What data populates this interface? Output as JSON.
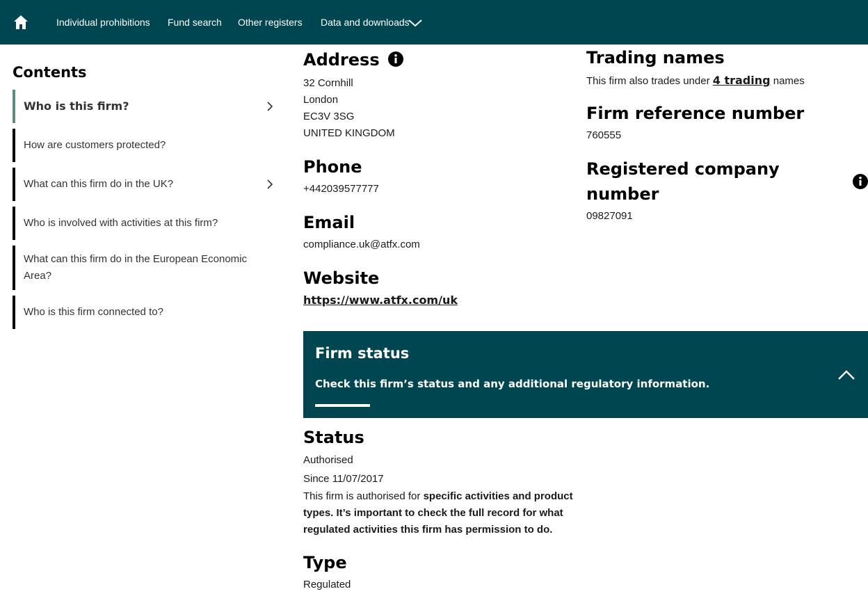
{
  "nav": {
    "home_icon": "home-icon",
    "items": [
      {
        "label": "Individual prohibitions"
      },
      {
        "label": "Fund search"
      },
      {
        "label": "Other registers"
      },
      {
        "label": "Data and downloads"
      }
    ]
  },
  "sidebar": {
    "title": "Contents",
    "items": [
      {
        "label": "Who is this firm?"
      },
      {
        "label": "How are customers protected?"
      },
      {
        "label": "What can this firm do in the UK?"
      },
      {
        "label": "Who is involved with activities at this firm?"
      },
      {
        "label": "What can this firm do in the European Economic Area?"
      },
      {
        "label": "Who is this firm connected to?"
      }
    ]
  },
  "address": {
    "heading": "Address",
    "lines": [
      "32 Cornhill",
      "London",
      "EC3V 3SG",
      "UNITED KINGDOM"
    ]
  },
  "phone": {
    "heading": "Phone",
    "value": "+442039577777"
  },
  "email": {
    "heading": "Email",
    "value": "compliance.uk@atfx.com"
  },
  "website": {
    "heading": "Website",
    "value": "https://www.atfx.com/uk"
  },
  "trading": {
    "heading": "Trading names",
    "text_before": "This firm also trades under ",
    "link": "4 trading",
    "text_after": " names"
  },
  "frn": {
    "heading": "Firm reference number",
    "value": "760555"
  },
  "company": {
    "heading_line1": "Registered company",
    "heading_line2": "number",
    "value": "09827091"
  },
  "firm_status": {
    "title": "Firm status",
    "subtitle": "Check this firm’s status and any additional regulatory information."
  },
  "status": {
    "heading": "Status",
    "value": "Authorised",
    "since": "Since 11/07/2017",
    "para_plain": "This firm is authorised for ",
    "para_bold": "specific activities and product types. It’s important to check the full record for what regulated activities this firm has permission to do."
  },
  "type": {
    "heading": "Type",
    "value": "Regulated"
  },
  "colors": {
    "brand": "#004650",
    "active_border": "#5e8a82"
  }
}
